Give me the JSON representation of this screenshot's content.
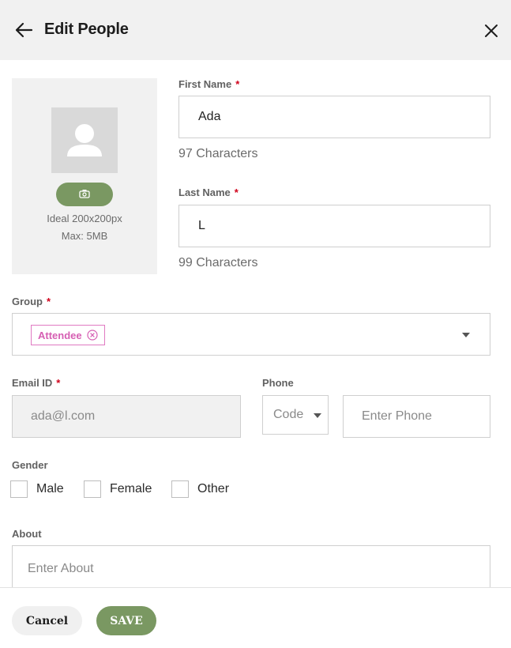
{
  "header": {
    "title": "Edit People",
    "back_icon": "arrow-left-icon",
    "close_icon": "close-icon"
  },
  "photo": {
    "hint_size": "Ideal 200x200px",
    "hint_max": "Max: 5MB",
    "camera_icon": "camera-icon",
    "placeholder_icon": "user-silhouette-icon"
  },
  "first_name": {
    "label": "First Name",
    "required": "*",
    "value": "Ada",
    "counter": "97 Characters"
  },
  "last_name": {
    "label": "Last Name",
    "required": "*",
    "value": "L",
    "counter": "99 Characters"
  },
  "group": {
    "label": "Group",
    "required": "*",
    "chip": "Attendee"
  },
  "email": {
    "label": "Email ID",
    "required": "*",
    "value": "ada@l.com"
  },
  "phone": {
    "label": "Phone",
    "code_placeholder": "Code",
    "placeholder": "Enter Phone"
  },
  "gender": {
    "label": "Gender",
    "options": [
      "Male",
      "Female",
      "Other"
    ]
  },
  "about": {
    "label": "About",
    "placeholder": "Enter About"
  },
  "footer": {
    "cancel": "Cancel",
    "save": "SAVE"
  },
  "colors": {
    "accent_green": "#7a9862",
    "chip_pink": "#d65fb3",
    "required_red": "#d0021b"
  }
}
